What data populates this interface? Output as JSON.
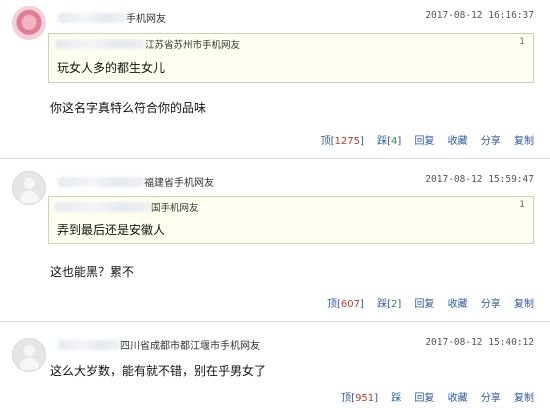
{
  "comments": [
    {
      "user_suffix": "手机网友",
      "time": "2017-08-12 16:16:37",
      "quote": {
        "user_suffix": "江苏省苏州市手机网友",
        "floor": "1",
        "text": "玩女人多的都生女儿"
      },
      "reply": "你这名字真特么符合你的品味",
      "actions": {
        "up": "顶",
        "up_count": "1275",
        "down": "踩",
        "down_count": "4",
        "reply": "回复",
        "fav": "收藏",
        "share": "分享",
        "copy": "复制"
      }
    },
    {
      "user_suffix": "福建省手机网友",
      "time": "2017-08-12 15:59:47",
      "quote": {
        "user_suffix": "国手机网友",
        "floor": "1",
        "text": "弄到最后还是安徽人"
      },
      "reply": "这也能黑？累不",
      "actions": {
        "up": "顶",
        "up_count": "607",
        "down": "踩",
        "down_count": "2",
        "reply": "回复",
        "fav": "收藏",
        "share": "分享",
        "copy": "复制"
      }
    },
    {
      "user_suffix": "四川省成都市都江堰市手机网友",
      "time": "2017-08-12 15:40:12",
      "reply": "这么大岁数，能有就不错，别在乎男女了",
      "actions": {
        "up": "顶",
        "up_count": "951",
        "down": "踩",
        "down_count": "",
        "reply": "回复",
        "fav": "收藏",
        "share": "分享",
        "copy": "复制"
      }
    }
  ]
}
